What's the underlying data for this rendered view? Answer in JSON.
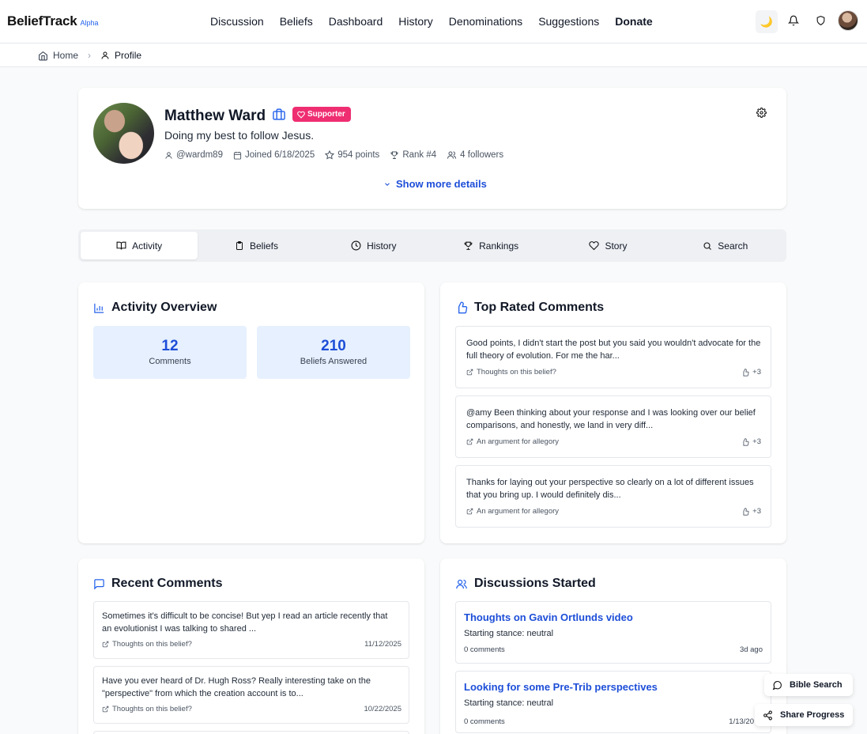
{
  "app": {
    "name": "BeliefTrack",
    "tag": "Alpha"
  },
  "nav": {
    "items": [
      {
        "label": "Discussion"
      },
      {
        "label": "Beliefs"
      },
      {
        "label": "Dashboard"
      },
      {
        "label": "History"
      },
      {
        "label": "Denominations"
      },
      {
        "label": "Suggestions"
      },
      {
        "label": "Donate"
      }
    ],
    "theme_icon": "🌙"
  },
  "breadcrumb": {
    "home": "Home",
    "current": "Profile"
  },
  "profile": {
    "name": "Matthew Ward",
    "badge": "Supporter",
    "bio": "Doing my best to follow Jesus.",
    "username": "@wardm89",
    "joined": "Joined 6/18/2025",
    "points": "954 points",
    "rank": "Rank #4",
    "followers": "4 followers",
    "show_more": "Show more details"
  },
  "tabs": [
    {
      "label": "Activity"
    },
    {
      "label": "Beliefs"
    },
    {
      "label": "History"
    },
    {
      "label": "Rankings"
    },
    {
      "label": "Story"
    },
    {
      "label": "Search"
    }
  ],
  "overview": {
    "title": "Activity Overview",
    "stats": [
      {
        "value": "12",
        "label": "Comments"
      },
      {
        "value": "210",
        "label": "Beliefs Answered"
      }
    ]
  },
  "top_rated": {
    "title": "Top Rated Comments",
    "items": [
      {
        "text": "Good points, I didn't start the post but you said you wouldn't advocate for the full theory of evolution. For me the har...",
        "source": "Thoughts on this belief?",
        "score": "+3"
      },
      {
        "text": "@amy Been thinking about your response and I was looking over our belief comparisons, and honestly, we land in very diff...",
        "source": "An argument for allegory",
        "score": "+3"
      },
      {
        "text": "Thanks for laying out your perspective so clearly on a lot of different issues that you bring up. I would definitely dis...",
        "source": "An argument for allegory",
        "score": "+3"
      }
    ]
  },
  "recent": {
    "title": "Recent Comments",
    "items": [
      {
        "text": "Sometimes it's difficult to be concise! But yep I read an article recently that an evolutionist I was talking to shared ...",
        "source": "Thoughts on this belief?",
        "date": "11/12/2025"
      },
      {
        "text": "Have you ever heard of Dr. Hugh Ross? Really interesting take on the \"perspective\" from which the creation account is to...",
        "source": "Thoughts on this belief?",
        "date": "10/22/2025"
      }
    ]
  },
  "discussions": {
    "title": "Discussions Started",
    "items": [
      {
        "title": "Thoughts on Gavin Ortlunds video",
        "stance": "Starting stance: neutral",
        "comments": "0 comments",
        "time": "3d ago"
      },
      {
        "title": "Looking for some Pre-Trib perspectives",
        "stance": "Starting stance: neutral",
        "comments": "0 comments",
        "time": "1/13/20"
      }
    ]
  },
  "floating": {
    "bible_search": "Bible Search",
    "share_progress": "Share Progress"
  },
  "colors": {
    "accent": "#1d4ed8",
    "supporter": "#ef2e72",
    "stat_bg": "#e6f0fe"
  }
}
